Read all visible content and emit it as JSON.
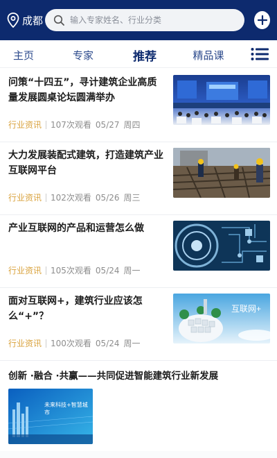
{
  "header": {
    "location": "成都",
    "search_placeholder": "输入专家姓名、行业分类"
  },
  "tabs": [
    {
      "label": "主页"
    },
    {
      "label": "专家"
    },
    {
      "label": "推荐"
    },
    {
      "label": "精品课"
    }
  ],
  "articles": [
    {
      "title": "问策“十四五”，寻计建筑企业高质量发展圆桌论坛圆满举办",
      "category": "行业资讯",
      "views": "107次观看",
      "date": "05/27",
      "weekday": "周四"
    },
    {
      "title": "大力发展装配式建筑，打造建筑产业互联网平台",
      "category": "行业资讯",
      "views": "102次观看",
      "date": "05/26",
      "weekday": "周三"
    },
    {
      "title": "产业互联网的产品和运营怎么做",
      "category": "行业资讯",
      "views": "105次观看",
      "date": "05/24",
      "weekday": "周一"
    },
    {
      "title": "面对互联网+，建筑行业应该怎么“+”？",
      "category": "行业资讯",
      "views": "100次观看",
      "date": "05/24",
      "weekday": "周一",
      "thumb_text": "互联网+"
    }
  ],
  "banner": {
    "title": "创新 ·融合 ·共赢——共同促进智能建筑行业新发展",
    "image_text": "未来科技+智慧城市"
  }
}
